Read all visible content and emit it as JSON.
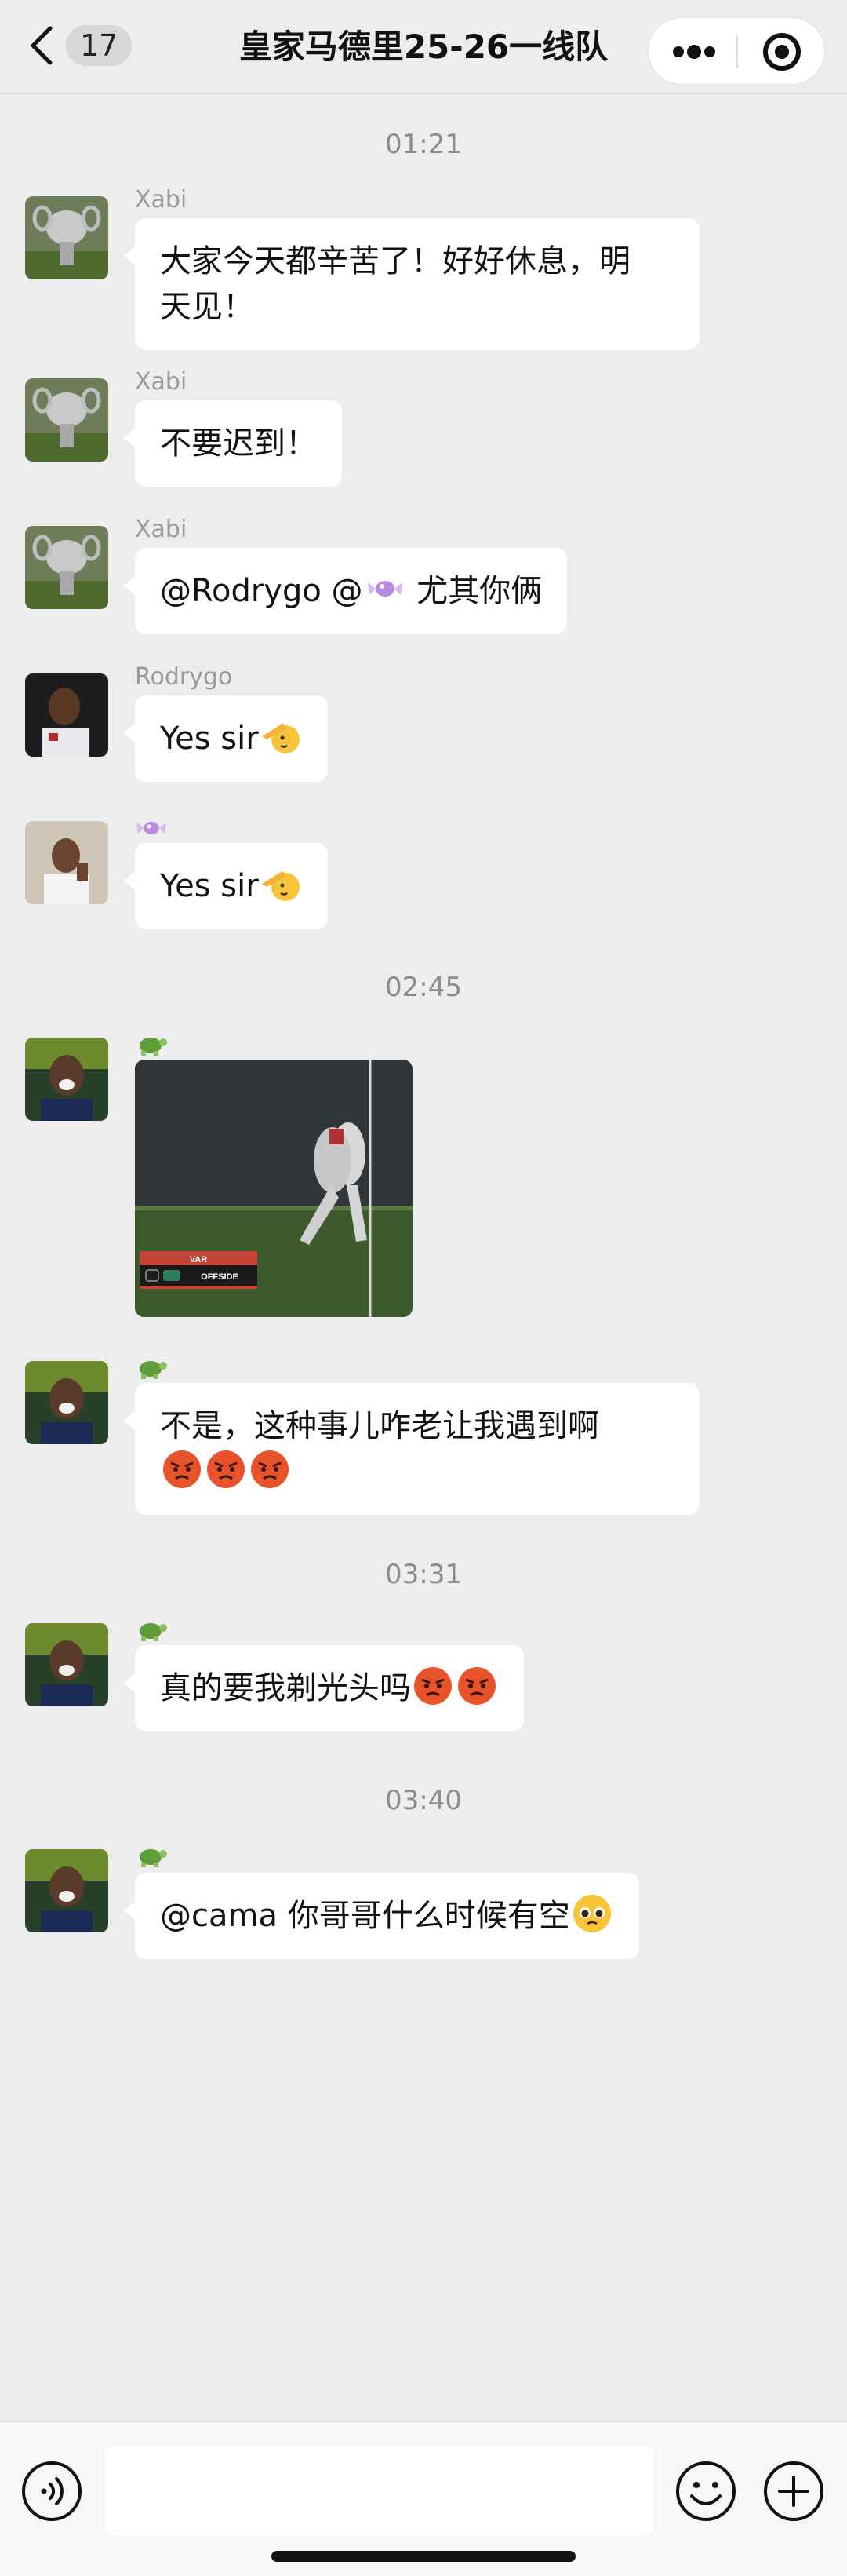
{
  "header": {
    "unread_count": "17",
    "title": "皇家马德里25-26一线队"
  },
  "timestamps": [
    "01:21",
    "02:45",
    "03:31",
    "03:40"
  ],
  "messages": [
    {
      "sender": "Xabi",
      "text_line1": "大家今天都辛苦了！好好休息，明",
      "text_line2": "天见！"
    },
    {
      "sender": "Xabi",
      "text": "不要迟到！"
    },
    {
      "sender": "Xabi",
      "mention1": "@Rodrygo @",
      "text_after": " 尤其你俩"
    },
    {
      "sender": "Rodrygo",
      "text": "Yes sir"
    },
    {
      "sender": "",
      "text": "Yes sir"
    },
    {
      "sender": "",
      "image_label": "VAR",
      "image_caption": "OFFSIDE"
    },
    {
      "sender": "",
      "text": "不是，这种事儿咋老让我遇到啊"
    },
    {
      "sender": "",
      "text": "真的要我剃光头吗"
    },
    {
      "sender": "",
      "text": "@cama 你哥哥什么时候有空"
    }
  ],
  "icons": {
    "back": "chevron-left-icon",
    "more": "more-dots-icon",
    "close": "mini-program-close-icon",
    "voice": "voice-icon",
    "sticker": "smiley-icon",
    "plus": "plus-icon"
  },
  "colors": {
    "background": "#ededed",
    "bubble": "#ffffff",
    "timestamp": "#8c8c8c",
    "sender": "#9a9a9a"
  }
}
